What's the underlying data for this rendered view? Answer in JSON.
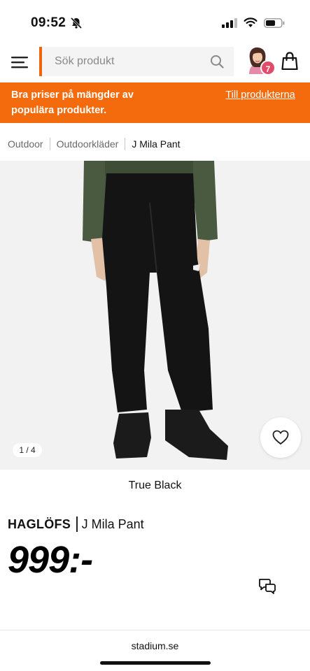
{
  "status": {
    "time": "09:52"
  },
  "header": {
    "search_placeholder": "Sök produkt",
    "cart_count": "7"
  },
  "promo": {
    "text": "Bra priser på mängder av populära produkter.",
    "link": "Till produkterna"
  },
  "breadcrumb": [
    "Outdoor",
    "Outdoorkläder",
    "J Mila Pant"
  ],
  "gallery": {
    "pager": "1 / 4"
  },
  "product": {
    "color": "True Black",
    "brand": "HAGLÖFS",
    "name": "J Mila Pant",
    "price": "999:-"
  },
  "browser": {
    "url": "stadium.se"
  },
  "colors": {
    "accent": "#f36b0c",
    "badge": "#e24b6a",
    "jacket": "#4a5a40",
    "pants": "#141414"
  }
}
